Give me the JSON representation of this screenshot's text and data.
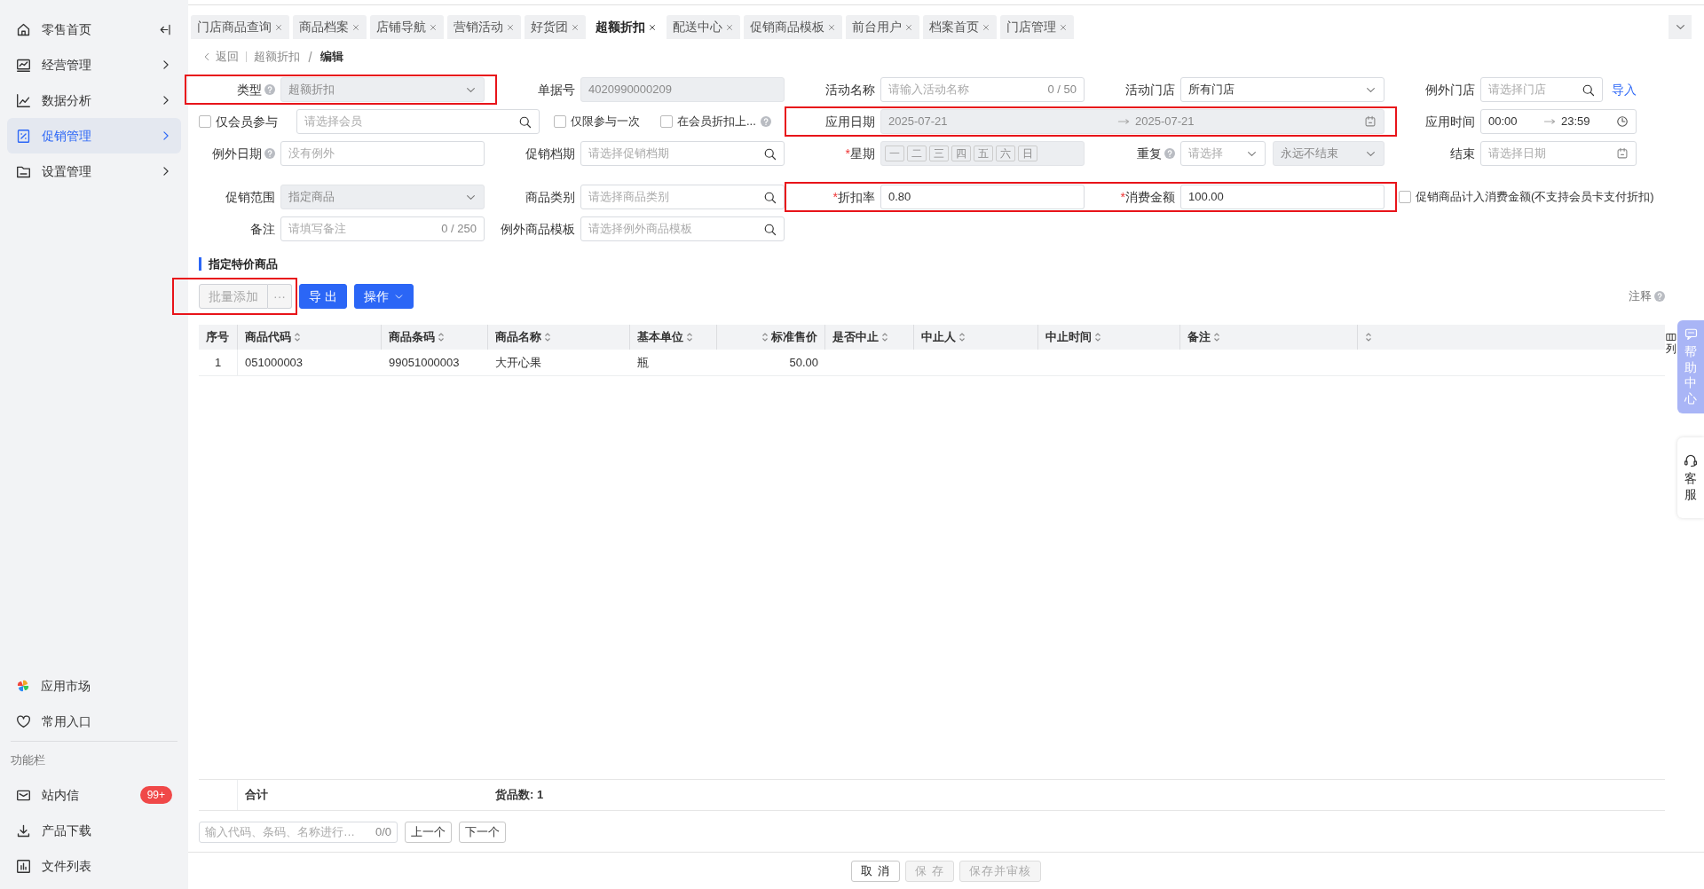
{
  "sidebar": {
    "items": [
      {
        "label": "零售首页",
        "selected": false
      },
      {
        "label": "经营管理",
        "selected": false
      },
      {
        "label": "数据分析",
        "selected": false
      },
      {
        "label": "促销管理",
        "selected": true
      },
      {
        "label": "设置管理",
        "selected": false
      }
    ],
    "shortcuts": [
      {
        "label": "应用市场"
      },
      {
        "label": "常用入口"
      }
    ],
    "section_title": "功能栏",
    "tools": [
      {
        "label": "站内信",
        "badge": "99+"
      },
      {
        "label": "产品下载"
      },
      {
        "label": "文件列表"
      }
    ]
  },
  "tabs": [
    {
      "label": "门店商品查询",
      "selected": false
    },
    {
      "label": "商品档案",
      "selected": false
    },
    {
      "label": "店铺导航",
      "selected": false
    },
    {
      "label": "营销活动",
      "selected": false
    },
    {
      "label": "好货团",
      "selected": false
    },
    {
      "label": "超额折扣",
      "selected": true
    },
    {
      "label": "配送中心",
      "selected": false
    },
    {
      "label": "促销商品模板",
      "selected": false
    },
    {
      "label": "前台用户",
      "selected": false
    },
    {
      "label": "档案首页",
      "selected": false
    },
    {
      "label": "门店管理",
      "selected": false
    }
  ],
  "breadcrumb": {
    "back": "返回",
    "parent": "超额折扣",
    "current": "编辑"
  },
  "form": {
    "rows": [
      [
        {
          "kind": "select",
          "label": "类型",
          "help": true,
          "value": "超额折扣",
          "disabled": true,
          "highlighted": true
        },
        {
          "kind": "input",
          "label": "单据号",
          "help": false,
          "value": "4020990000209",
          "disabled": true,
          "highlighted": false
        },
        {
          "kind": "input",
          "label": "活动名称",
          "help": false,
          "placeholder": "请输入活动名称",
          "counter": "0 / 50",
          "disabled": false,
          "highlighted": false
        },
        {
          "kind": "select",
          "label": "活动门店",
          "help": false,
          "value": "所有门店",
          "disabled": false,
          "highlighted": false
        },
        {
          "kind": "search",
          "label": "例外门店",
          "help": false,
          "placeholder": "请选择门店",
          "link": "导入",
          "disabled": false,
          "highlighted": false
        }
      ],
      [
        {
          "kind": "checkbox-search",
          "label": "仅会员参与",
          "checked": false,
          "help": false,
          "placeholder": "请选择会员",
          "highlighted": false
        },
        {
          "kind": "checkbox",
          "label": "仅限参与一次",
          "checked": false,
          "help": false,
          "highlighted": false
        },
        {
          "kind": "checkbox",
          "label": "在会员折扣上...",
          "checked": false,
          "help": true,
          "highlighted": false
        },
        {
          "kind": "date-range",
          "label": "应用日期",
          "help": false,
          "start": "2025-07-21",
          "end": "2025-07-21",
          "disabled": true,
          "highlighted": true
        },
        {
          "kind": "time-range",
          "label": "应用时间",
          "help": false,
          "start": "00:00",
          "end": "23:59",
          "disabled": false,
          "highlighted": false
        }
      ],
      [
        {
          "kind": "input",
          "label": "例外日期",
          "help": true,
          "placeholder": "没有例外",
          "disabled": false,
          "highlighted": false
        },
        {
          "kind": "search",
          "label": "促销档期",
          "help": false,
          "placeholder": "请选择促销档期",
          "disabled": false,
          "highlighted": false
        },
        {
          "kind": "weekdays",
          "label": "星期",
          "help": false,
          "required_mark": "*",
          "days": [
            "一",
            "二",
            "三",
            "四",
            "五",
            "六",
            "日"
          ],
          "disabled": true,
          "highlighted": false
        },
        {
          "kind": "double-select",
          "label": "重复",
          "help": true,
          "placeholder": "请选择",
          "value": "永远不结束",
          "disabled": true,
          "highlighted": false
        },
        {
          "kind": "date",
          "label": "结束",
          "help": false,
          "placeholder": "请选择日期",
          "disabled": false,
          "highlighted": false
        }
      ],
      [
        {
          "kind": "select",
          "label": "促销范围",
          "help": false,
          "value": "指定商品",
          "disabled": true,
          "highlighted": false
        },
        {
          "kind": "search",
          "label": "商品类别",
          "help": false,
          "placeholder": "请选择商品类别",
          "disabled": false,
          "highlighted": false
        },
        {
          "kind": "input",
          "label": "折扣率",
          "help": false,
          "required_mark": "*",
          "value": "0.80",
          "disabled": false,
          "highlighted": true
        },
        {
          "kind": "input",
          "label": "消费金额",
          "help": false,
          "required_mark": "*",
          "value": "100.00",
          "disabled": false,
          "highlighted": true
        },
        {
          "kind": "checkbox",
          "label": "促销商品计入消费金额(不支持会员卡支付折扣)",
          "checked": false,
          "help": false,
          "highlighted": false
        }
      ],
      [
        {
          "kind": "input",
          "label": "备注",
          "help": false,
          "placeholder": "请填写备注",
          "counter": "0 / 250",
          "disabled": false,
          "highlighted": false
        },
        {
          "kind": "search",
          "label": "例外商品模板",
          "help": false,
          "placeholder": "请选择例外商品模板",
          "disabled": false,
          "highlighted": false
        }
      ]
    ]
  },
  "section_title": "指定特价商品",
  "toolbar": {
    "buttons": [
      {
        "label": "批量添加",
        "kind": "secondary",
        "disabled": true,
        "highlighted": true
      },
      {
        "label": "···",
        "kind": "secondary",
        "disabled": true,
        "highlighted": true
      },
      {
        "label": "导 出",
        "kind": "primary",
        "disabled": false,
        "highlighted": false
      },
      {
        "label": "操作",
        "kind": "dropdown",
        "disabled": false,
        "highlighted": false
      }
    ],
    "note": "注释"
  },
  "table": {
    "columns": [
      {
        "label": "序号",
        "sortable": false,
        "numeric": false
      },
      {
        "label": "商品代码",
        "sortable": true,
        "numeric": false
      },
      {
        "label": "商品条码",
        "sortable": true,
        "numeric": false
      },
      {
        "label": "商品名称",
        "sortable": true,
        "numeric": false
      },
      {
        "label": "基本单位",
        "sortable": true,
        "numeric": false
      },
      {
        "label": "标准售价",
        "sortable": true,
        "numeric": true
      },
      {
        "label": "是否中止",
        "sortable": true,
        "numeric": false
      },
      {
        "label": "中止人",
        "sortable": true,
        "numeric": false
      },
      {
        "label": "中止时间",
        "sortable": true,
        "numeric": false
      },
      {
        "label": "备注",
        "sortable": true,
        "numeric": false
      },
      {
        "sortable": true,
        "numeric": false
      }
    ],
    "rows": [
      {
        "cells": [
          "1",
          "051000003",
          "99051000003",
          "大开心果",
          "瓶",
          "50.00"
        ]
      }
    ],
    "column_settings": "列",
    "footer": {
      "total_label": "合计",
      "count": "货品数: 1"
    }
  },
  "finder": {
    "placeholder": "输入代码、条码、名称进行…",
    "counter": "0/0",
    "prev": "上一个",
    "next": "下一个"
  },
  "actions": [
    {
      "label": "取 消",
      "disabled": false
    },
    {
      "label": "保 存",
      "disabled": true
    },
    {
      "label": "保存并审核",
      "disabled": true
    }
  ],
  "side_tabs": [
    {
      "label": "帮助中心",
      "kind": "help"
    },
    {
      "label": "客服",
      "kind": "service"
    }
  ]
}
